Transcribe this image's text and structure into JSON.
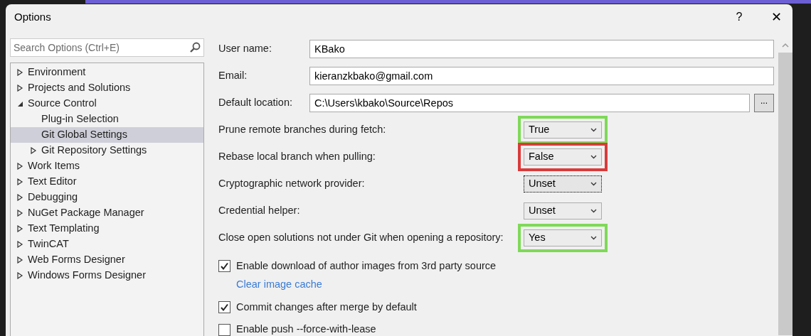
{
  "window": {
    "title": "Options",
    "help": "?",
    "close": "✕"
  },
  "search": {
    "placeholder": "Search Options (Ctrl+E)"
  },
  "tree": [
    {
      "label": "Environment",
      "expanded": false,
      "selected": false
    },
    {
      "label": "Projects and Solutions",
      "expanded": false,
      "selected": false
    },
    {
      "label": "Source Control",
      "expanded": true,
      "selected": false,
      "children": [
        {
          "label": "Plug-in Selection",
          "selected": false
        },
        {
          "label": "Git Global Settings",
          "selected": true
        },
        {
          "label": "Git Repository Settings",
          "expanded": false,
          "selected": false
        }
      ]
    },
    {
      "label": "Work Items",
      "expanded": false,
      "selected": false
    },
    {
      "label": "Text Editor",
      "expanded": false,
      "selected": false
    },
    {
      "label": "Debugging",
      "expanded": false,
      "selected": false
    },
    {
      "label": "NuGet Package Manager",
      "expanded": false,
      "selected": false
    },
    {
      "label": "Text Templating",
      "expanded": false,
      "selected": false
    },
    {
      "label": "TwinCAT",
      "expanded": false,
      "selected": false
    },
    {
      "label": "Web Forms Designer",
      "expanded": false,
      "selected": false
    },
    {
      "label": "Windows Forms Designer",
      "expanded": false,
      "selected": false
    }
  ],
  "fields": [
    {
      "label": "User name:",
      "value": "KBako"
    },
    {
      "label": "Email:",
      "value": "kieranzkbako@gmail.com"
    },
    {
      "label": "Default location:",
      "value": "C:\\Users\\kbako\\Source\\Repos",
      "button": "..."
    }
  ],
  "dropdowns": [
    {
      "label": "Prune remote branches during fetch:",
      "value": "True",
      "focused": false,
      "color": "#7ed957"
    },
    {
      "label": "Rebase local branch when pulling:",
      "value": "False",
      "focused": false,
      "color": "#d93a3a"
    },
    {
      "label": "Cryptographic network provider:",
      "value": "Unset",
      "focused": true
    },
    {
      "label": "Credential helper:",
      "value": "Unset",
      "focused": false
    },
    {
      "label": "Close open solutions not under Git when opening a repository:",
      "value": "Yes",
      "focused": false,
      "color": "#7ed957"
    }
  ],
  "checkboxes": [
    {
      "label": "Enable download of author images from 3rd party source",
      "checked": true,
      "link": "Clear image cache"
    },
    {
      "label": "Commit changes after merge by default",
      "checked": true
    },
    {
      "label": "Enable push --force-with-lease",
      "checked": false
    }
  ]
}
